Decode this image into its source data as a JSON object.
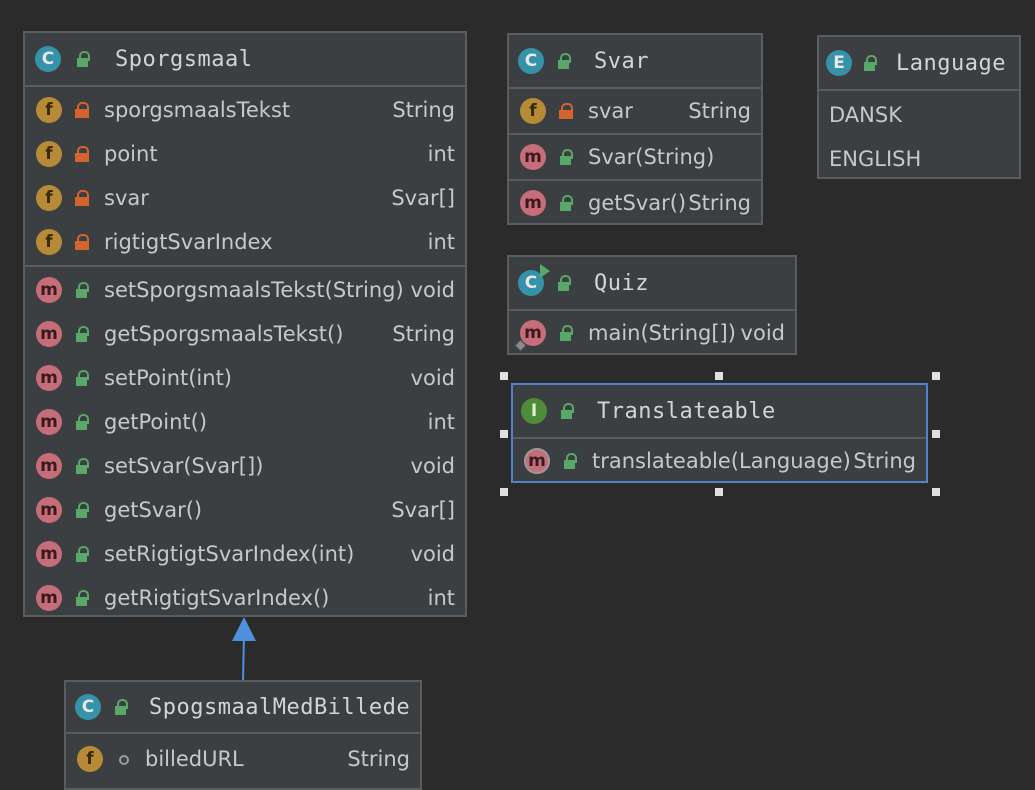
{
  "classes": {
    "sporgsmaal": {
      "name": "Sporgsmaal",
      "fields": [
        {
          "name": "sporgsmaalsTekst",
          "type": "String"
        },
        {
          "name": "point",
          "type": "int"
        },
        {
          "name": "svar",
          "type": "Svar[]"
        },
        {
          "name": "rigtigtSvarIndex",
          "type": "int"
        }
      ],
      "methods": [
        {
          "name": "setSporgsmaalsTekst(String)",
          "type": "void"
        },
        {
          "name": "getSporgsmaalsTekst()",
          "type": "String"
        },
        {
          "name": "setPoint(int)",
          "type": "void"
        },
        {
          "name": "getPoint()",
          "type": "int"
        },
        {
          "name": "setSvar(Svar[])",
          "type": "void"
        },
        {
          "name": "getSvar()",
          "type": "Svar[]"
        },
        {
          "name": "setRigtigtSvarIndex(int)",
          "type": "void"
        },
        {
          "name": "getRigtigtSvarIndex()",
          "type": "int"
        }
      ]
    },
    "svar": {
      "name": "Svar",
      "fields": [
        {
          "name": "svar",
          "type": "String"
        }
      ],
      "constructors": [
        {
          "name": "Svar(String)",
          "type": ""
        }
      ],
      "methods": [
        {
          "name": "getSvar()",
          "type": "String"
        }
      ]
    },
    "language": {
      "name": "Language",
      "constants": [
        "DANSK",
        "ENGLISH"
      ]
    },
    "quiz": {
      "name": "Quiz",
      "methods": [
        {
          "name": "main(String[])",
          "type": "void"
        }
      ]
    },
    "translateable": {
      "name": "Translateable",
      "methods": [
        {
          "name": "translateable(Language)",
          "type": "String"
        }
      ]
    },
    "spogsmaalMedBillede": {
      "name": "SpogsmaalMedBillede",
      "fields": [
        {
          "name": "billedURL",
          "type": "String"
        }
      ]
    }
  },
  "badges": {
    "class": "C",
    "field": "f",
    "method": "m",
    "enum": "E",
    "interface": "I"
  },
  "colors": {
    "background": "#2b2b2b",
    "box": "#3c3f41",
    "border": "#5a5d5f",
    "selection": "#4f83cc",
    "arrow": "#4f8fdc"
  }
}
